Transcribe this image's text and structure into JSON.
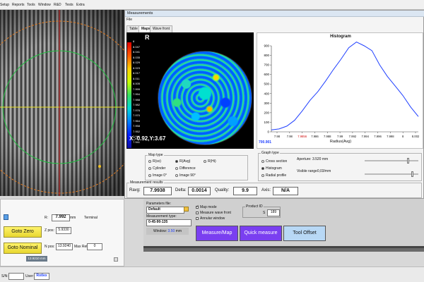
{
  "menu": {
    "items": [
      "Setup",
      "Reports",
      "Tools",
      "Window",
      "R&D",
      "Tests",
      "Extra"
    ]
  },
  "measurements": {
    "title": "Measurements",
    "file_menu": "File",
    "tabs": [
      "Table",
      "Maps",
      "Wave front"
    ],
    "map": {
      "label": "R",
      "colorbar_labels": [
        "8",
        "8.047",
        "8.041",
        "8.035",
        "8.029",
        "8.023",
        "8.017",
        "8.011",
        "8.005",
        "7.999",
        "7.994",
        "7.988",
        "7.982",
        "7.976",
        "7.970",
        "7.964",
        "7.958",
        "7.952",
        "7.946",
        "7.941"
      ],
      "coords": "X:-0.92,Y:3.67"
    },
    "histogram": {
      "title": "Histogram",
      "xlabel": "Radius(Avg)",
      "first_tick": "7.96",
      "x_ticks": [
        "7.98",
        "7.98",
        "7.9856",
        "7.986",
        "7.988",
        "7.99",
        "7.992",
        "7.994",
        "7.996",
        "7.998",
        "8",
        "8.002"
      ],
      "y_ticks": [
        "900",
        "800",
        "700",
        "600",
        "500",
        "400",
        "300",
        "200",
        "100",
        "0"
      ],
      "x_axis_left_value": "7.96",
      "y_axis_small": "8.0",
      "corner_value": "700.901"
    },
    "map_type": {
      "label": "Map type",
      "options": [
        "R(sx)",
        "R(Avg)",
        "R(Hi)",
        "Cylinder",
        "Difference",
        "Image 0°",
        "Image 90°"
      ],
      "selected": "R(Avg)"
    },
    "graph_type": {
      "label": "Graph type",
      "options": [
        "Cross section",
        "Histogram",
        "Radial profile"
      ],
      "selected": "Histogram",
      "aperture": "Aperture: 3.520 mm",
      "visible_range": "Visible range0,03/mm"
    },
    "results": {
      "label": "Measurement results",
      "ravg_label": "Ravg:",
      "ravg": "7.9938",
      "delta_label": "Delta:",
      "delta": "0.0014",
      "quality_label": "Quality:",
      "quality": "9.9",
      "axis_label": "Axis:",
      "axis": "N/A"
    }
  },
  "controls": {
    "r_label": "R:",
    "r_value": "7.992",
    "r_unit": "mm",
    "terminal": "Terminal",
    "goto_zero": "Goto Zero",
    "zpos_label": "Z pos:",
    "zpos": "5.9330",
    "goto_nominal": "Goto Nominal",
    "npos_label": "N pos:",
    "npos": "13.9240",
    "max_ret_label": "Max Ret:",
    "max_ret": "0",
    "footer_value": "13.9210 mm"
  },
  "parameters": {
    "file_label": "Parameters file:",
    "file_value": "Default",
    "type_label": "Measurement type:",
    "type_value": "0-45-90-135",
    "window_label": "Window:",
    "window_value": "3.50",
    "window_unit": "mm",
    "map_mode": "Map mode",
    "measure_wave_front": "Measure wave front",
    "annular_window": "Annular window",
    "product_id_label": "Product ID",
    "product_prefix": "S",
    "product_id": "189",
    "measure_map_btn": "Measure/Map",
    "quick_measure_btn": "Quick measure",
    "tool_offset_btn": "Tool Offset"
  },
  "statusbar": {
    "sn_label": "S/N:",
    "user_label": "User:",
    "user": "Rotlex"
  },
  "colors": {
    "purple_button": "#7a3ff0",
    "tool_offset": "#b8d8f5",
    "yellow_button": "#f2e44a",
    "histogram_line": "#1f3fff"
  }
}
